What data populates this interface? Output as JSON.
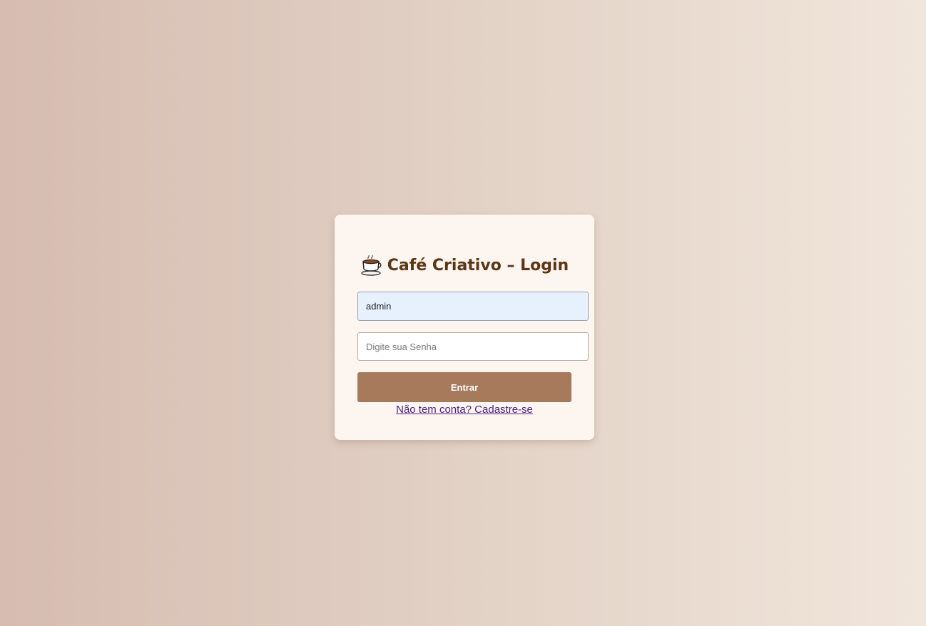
{
  "login": {
    "title": "Café Criativo – Login",
    "icon": "coffee-cup-icon",
    "username_value": "admin",
    "password_placeholder": "Digite sua Senha",
    "submit_label": "Entrar",
    "signup_link": "Não tem conta? Cadastre-se"
  },
  "colors": {
    "title": "#5b3716",
    "button": "#a77a5b",
    "link": "#4b2286",
    "card_background": "#fdf5ef"
  }
}
